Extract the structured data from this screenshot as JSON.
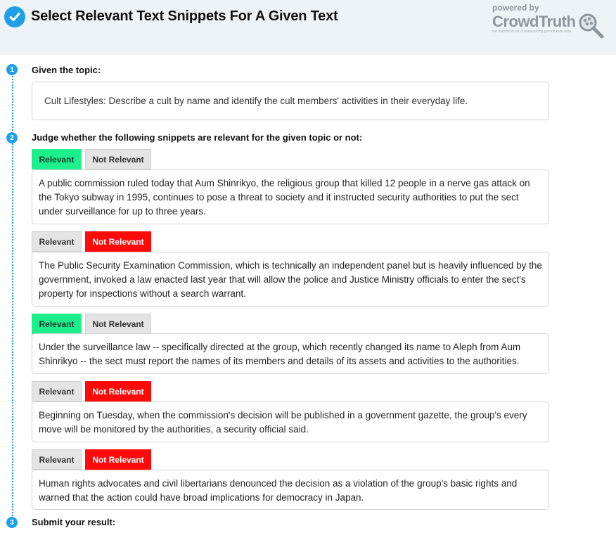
{
  "header": {
    "title": "Select Relevant Text Snippets For A Given Text",
    "brand_powered": "powered by",
    "brand_name": "CrowdTruth",
    "brand_tagline": "the framework for crowdsourcing ground truth data",
    "icon": "check-icon",
    "accent_color": "#1fa0e6"
  },
  "steps": [
    {
      "number": "1",
      "label": "Given the topic:"
    },
    {
      "number": "2",
      "label": "Judge whether the following snippets are relevant for the given topic or not:"
    },
    {
      "number": "3",
      "label": "Submit your result:"
    }
  ],
  "topic": "Cult Lifestyles: Describe a cult by name and identify the cult members' activities in their everyday life.",
  "buttons": {
    "relevant": "Relevant",
    "not_relevant": "Not Relevant"
  },
  "colors": {
    "relevant_selected": "#1cf08d",
    "not_relevant_selected": "#ff0a0a",
    "unselected": "#e4e4e4"
  },
  "snippets": [
    {
      "selected": "Relevant",
      "text": "A public commission ruled today that Aum Shinrikyo, the religious group that killed 12 people in a nerve gas attack on the Tokyo subway in 1995, continues to pose a threat to society and it instructed security authorities to put the sect under surveillance for up to three years."
    },
    {
      "selected": "Not Relevant",
      "text": "The Public Security Examination Commission, which is technically an independent panel but is heavily influenced by the government, invoked a law enacted last year that will allow the police and Justice Ministry officials to enter the sect's property for inspections without a search warrant."
    },
    {
      "selected": "Relevant",
      "text": "Under the surveillance law -- specifically directed at the group, which recently changed its name to Aleph from Aum Shinrikyo -- the sect must report the names of its members and details of its assets and activities to the authorities."
    },
    {
      "selected": "Not Relevant",
      "text": "Beginning on Tuesday, when the commission's decision will be published in a government gazette, the group's every move will be monitored by the authorities, a security official said."
    },
    {
      "selected": "Not Relevant",
      "text": "Human rights advocates and civil libertarians denounced the decision as a violation of the group's basic rights and warned that the action could have broad implications for democracy in Japan."
    }
  ]
}
